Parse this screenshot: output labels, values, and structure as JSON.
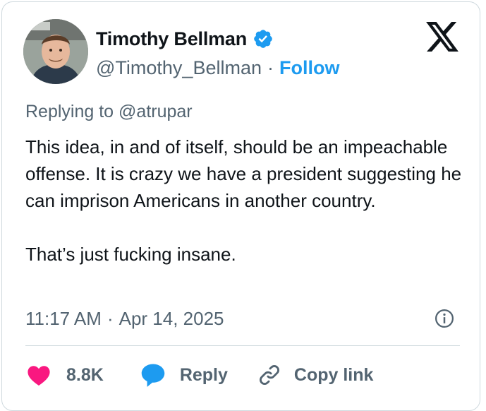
{
  "author": {
    "name": "Timothy Bellman",
    "handle": "@Timothy_Bellman",
    "separator": "·",
    "follow_label": "Follow",
    "verified_color": "#1d9bf0"
  },
  "platform_logo": "x-logo-icon",
  "tweet": {
    "replying_prefix": "Replying to",
    "replying_to": "@atrupar",
    "paragraphs": [
      "This idea, in and of itself, should be an impeachable offense. It is crazy we have a president suggesting he can imprison Americans in another country.",
      "That’s just fucking insane."
    ],
    "time": "11:17 AM",
    "date_separator": "·",
    "date": "Apr 14, 2025"
  },
  "actions": {
    "likes_count": "8.8K",
    "reply_label": "Reply",
    "copy_label": "Copy link",
    "heart_color": "#f91880",
    "reply_color": "#1d9bf0"
  }
}
